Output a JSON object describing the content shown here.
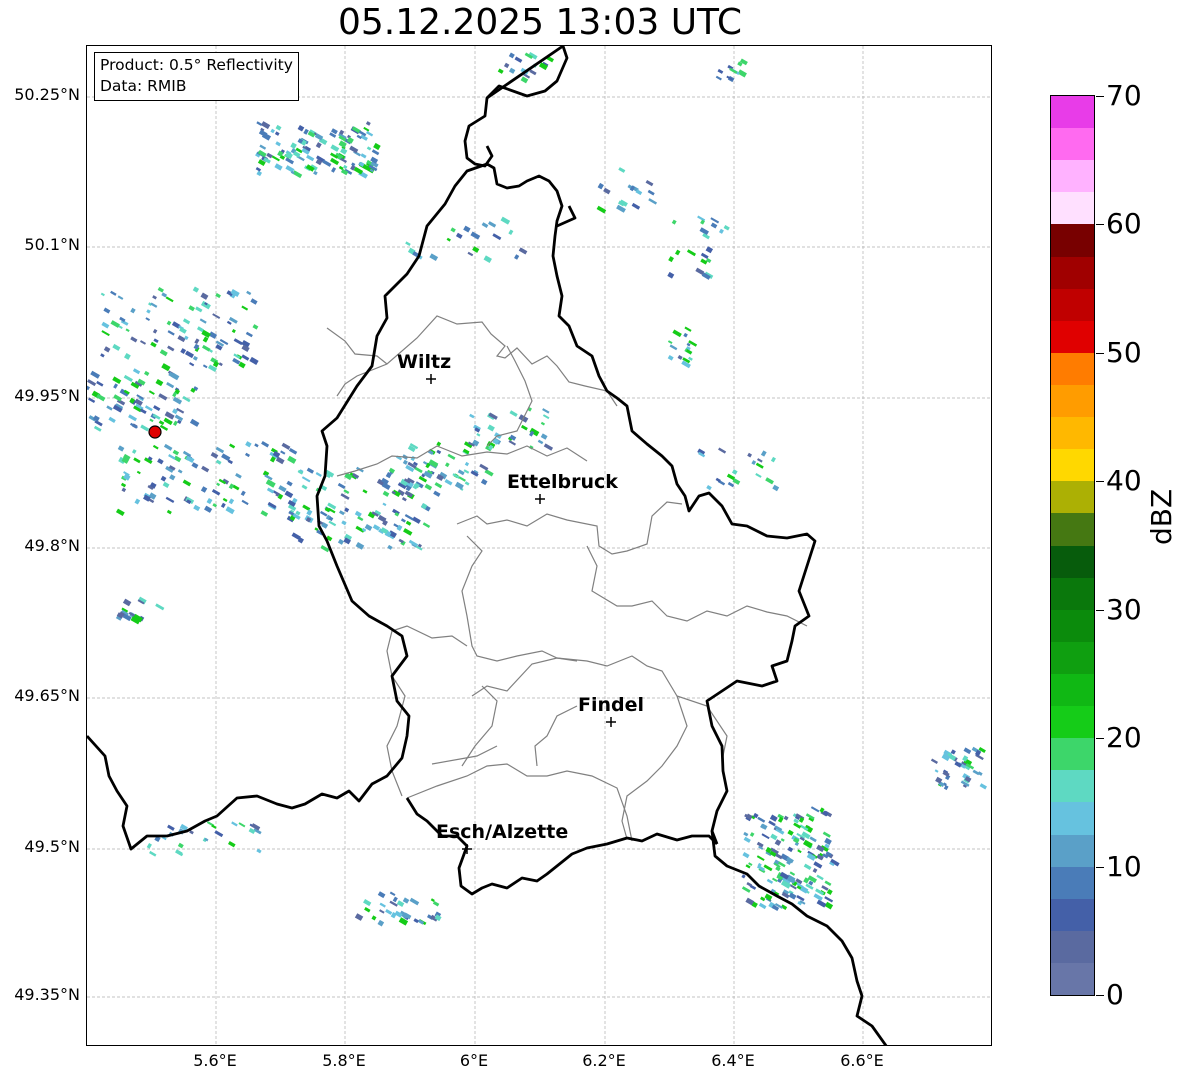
{
  "title": "05.12.2025 13:03 UTC",
  "info": {
    "product": "Product: 0.5° Reflectivity",
    "data": "Data: RMIB"
  },
  "lat_ticks": [
    "50.25°N",
    "50.1°N",
    "49.95°N",
    "49.8°N",
    "49.65°N",
    "49.5°N",
    "49.35°N"
  ],
  "lon_ticks": [
    "5.6°E",
    "5.8°E",
    "6°E",
    "6.2°E",
    "6.4°E",
    "6.6°E"
  ],
  "cities": [
    {
      "name": "Wiltz"
    },
    {
      "name": "Ettelbruck"
    },
    {
      "name": "Findel"
    },
    {
      "name": "Esch/Alzette"
    }
  ],
  "colorbar": {
    "unit": "dBZ",
    "ticks": [
      "70",
      "60",
      "50",
      "40",
      "30",
      "20",
      "10",
      "0"
    ],
    "range": [
      0,
      70
    ],
    "colors_top_to_bottom": [
      "#e83ce8",
      "#ff6af0",
      "#ffb2ff",
      "#ffe0ff",
      "#780000",
      "#a00000",
      "#c00000",
      "#e00000",
      "#ff7c00",
      "#ff9c00",
      "#ffb800",
      "#ffd800",
      "#acb004",
      "#457812",
      "#075c0c",
      "#0a780c",
      "#0b8b0c",
      "#0f9f10",
      "#10b814",
      "#15cc18",
      "#3dd66a",
      "#5ed9c2",
      "#66c2df",
      "#5aa0c8",
      "#4a7cb8",
      "#4460a8",
      "#5a6aa0",
      "#6876a8"
    ]
  },
  "radar_site_color": "#e00000"
}
